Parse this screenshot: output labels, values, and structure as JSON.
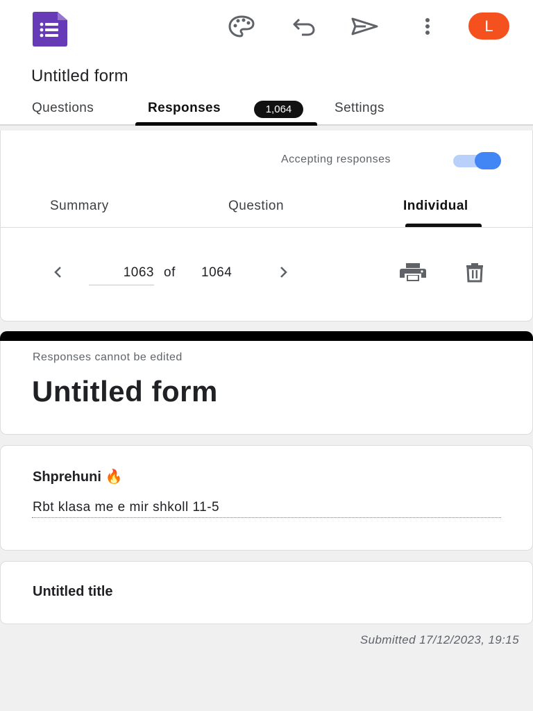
{
  "app": {
    "logo": "google-forms-logo",
    "avatar_initial": "L",
    "form_title": "Untitled form"
  },
  "toolbar": {
    "icons": [
      "palette-icon",
      "undo-icon",
      "send-icon",
      "more-vert-icon"
    ]
  },
  "tabs": {
    "questions": "Questions",
    "responses": "Responses",
    "responses_count": "1,064",
    "settings": "Settings",
    "active": "Responses"
  },
  "responses": {
    "accepting_label": "Accepting responses",
    "accepting_on": true,
    "subtabs": {
      "summary": "Summary",
      "question": "Question",
      "individual": "Individual",
      "active": "Individual"
    },
    "pager": {
      "current": "1063",
      "of": "of",
      "total": "1064"
    }
  },
  "response_view": {
    "cannot_edit": "Responses cannot be edited",
    "title": "Untitled form",
    "questions": [
      {
        "title": "Shprehuni 🔥",
        "answer": "Rbt klasa me e mir shkoll 11-5"
      },
      {
        "title": "Untitled title",
        "answer": ""
      }
    ],
    "submitted": "Submitted 17/12/2023, 19:15"
  },
  "colors": {
    "accent": "#4285f4",
    "logo_purple": "#673ab7",
    "avatar": "#f4511e"
  }
}
